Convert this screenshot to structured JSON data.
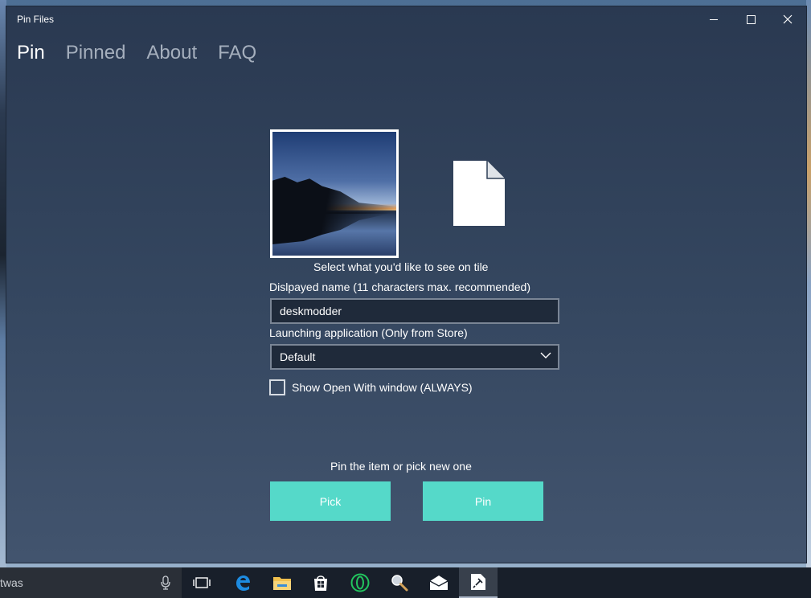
{
  "window": {
    "title": "Pin Files"
  },
  "nav": {
    "items": [
      {
        "label": "Pin",
        "active": true
      },
      {
        "label": "Pinned",
        "active": false
      },
      {
        "label": "About",
        "active": false
      },
      {
        "label": "FAQ",
        "active": false
      }
    ]
  },
  "tile": {
    "select_label": "Select what you'd like to see on tile",
    "image_icon": "landscape-photo",
    "file_icon": "document-icon"
  },
  "form": {
    "name_label": "Dislpayed name (11 characters max. recommended)",
    "name_value": "deskmodder",
    "launch_label": "Launching application (Only from Store)",
    "launch_value": "Default",
    "checkbox_label": "Show Open With window (ALWAYS)",
    "checkbox_checked": false
  },
  "actions": {
    "info": "Pin the item or pick new one",
    "pick_label": "Pick",
    "pin_label": "Pin",
    "accent_color": "#55d9c9"
  },
  "taskbar": {
    "search_text": "twas",
    "icons": [
      "mic-icon",
      "task-view-icon",
      "edge-icon",
      "file-explorer-icon",
      "store-icon",
      "opera-icon",
      "magnifier-icon",
      "mail-icon",
      "pin-files-icon"
    ],
    "active_icon": "pin-files-icon"
  }
}
